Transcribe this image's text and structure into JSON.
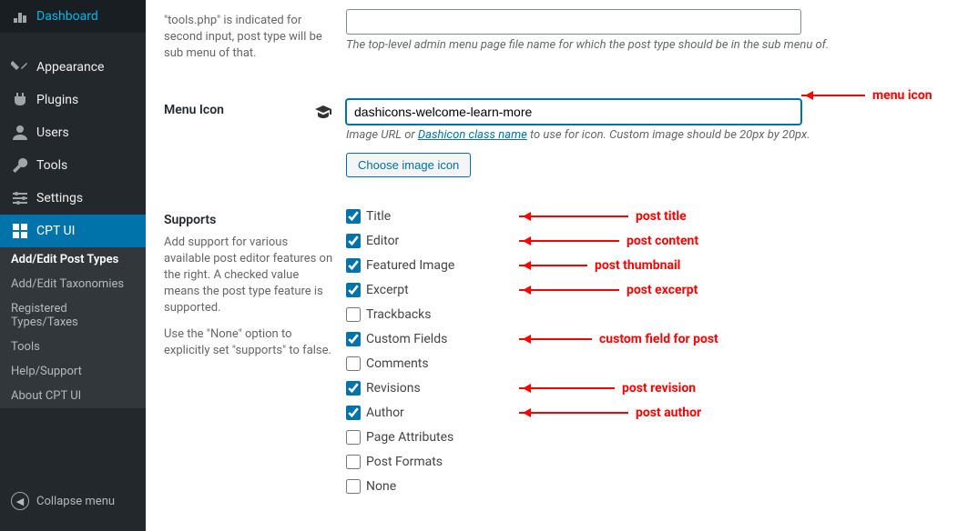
{
  "sidebar": {
    "items": [
      {
        "icon": "dashboard",
        "label": "Dashboard"
      },
      {
        "icon": "appearance",
        "label": "Appearance"
      },
      {
        "icon": "plugins",
        "label": "Plugins"
      },
      {
        "icon": "users",
        "label": "Users"
      },
      {
        "icon": "tools",
        "label": "Tools"
      },
      {
        "icon": "settings",
        "label": "Settings"
      },
      {
        "icon": "cpt",
        "label": "CPT UI"
      }
    ],
    "submenu": [
      "Add/Edit Post Types",
      "Add/Edit Taxonomies",
      "Registered Types/Taxes",
      "Tools",
      "Help/Support",
      "About CPT UI"
    ],
    "collapse": "Collapse menu"
  },
  "form": {
    "row_top_desc": "\"tools.php\" is indicated for second input, post type will be sub menu of that.",
    "row_top_help": "The top-level admin menu page file name for which the post type should be in the sub menu of.",
    "menu_icon": {
      "label": "Menu Icon",
      "value": "dashicons-welcome-learn-more",
      "help_prefix": "Image URL or ",
      "help_link": "Dashicon class name",
      "help_suffix": " to use for icon. Custom image should be 20px by 20px.",
      "button": "Choose image icon"
    },
    "supports": {
      "label": "Supports",
      "desc1": "Add support for various available post editor features on the right. A checked value means the post type feature is supported.",
      "desc2": "Use the \"None\" option to explicitly set \"supports\" to false.",
      "items": [
        {
          "label": "Title",
          "checked": true
        },
        {
          "label": "Editor",
          "checked": true
        },
        {
          "label": "Featured Image",
          "checked": true
        },
        {
          "label": "Excerpt",
          "checked": true
        },
        {
          "label": "Trackbacks",
          "checked": false
        },
        {
          "label": "Custom Fields",
          "checked": true
        },
        {
          "label": "Comments",
          "checked": false
        },
        {
          "label": "Revisions",
          "checked": true
        },
        {
          "label": "Author",
          "checked": true
        },
        {
          "label": "Page Attributes",
          "checked": false
        },
        {
          "label": "Post Formats",
          "checked": false
        },
        {
          "label": "None",
          "checked": false
        }
      ]
    }
  },
  "annotations": {
    "menu_icon": "menu icon",
    "title": "post title",
    "editor": "post content",
    "featured": "post thumbnail",
    "excerpt": "post excerpt",
    "custom_fields": "custom field for post",
    "revisions": "post revision",
    "author": "post author"
  }
}
